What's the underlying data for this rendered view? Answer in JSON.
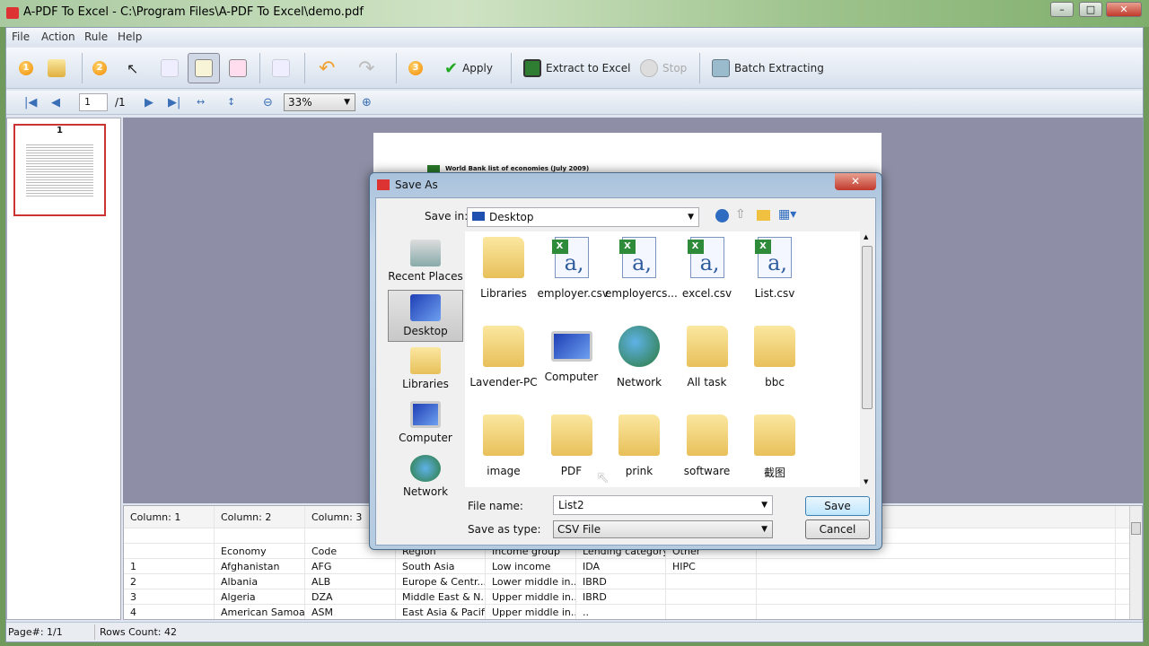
{
  "window": {
    "title": "A-PDF To Excel - C:\\Program Files\\A-PDF To Excel\\demo.pdf",
    "minimize": "–",
    "maximize": "□",
    "close": "✕"
  },
  "menu": [
    "File",
    "Action",
    "Rule",
    "Help"
  ],
  "toolbar": {
    "step1": "1",
    "step2": "2",
    "step3": "3",
    "apply": "Apply",
    "extract": "Extract to Excel",
    "stop": "Stop",
    "batch": "Batch Extracting"
  },
  "nav": {
    "page": "1",
    "total": "/1",
    "zoom": "33%"
  },
  "thumbnail": {
    "label": "1"
  },
  "pdf": {
    "heading": "World Bank list of economies (July 2009)"
  },
  "grid": {
    "headers": [
      "Column: 1",
      "Column: 2",
      "Column: 3",
      "",
      "",
      "",
      "",
      ""
    ],
    "rows": [
      [
        "",
        "",
        "",
        "",
        "",
        "",
        "",
        ""
      ],
      [
        "",
        "Economy",
        "Code",
        "Region",
        "Income group",
        "Lending category",
        "Other",
        ""
      ],
      [
        "1",
        "Afghanistan",
        "AFG",
        "South Asia",
        "Low income",
        "IDA",
        "HIPC",
        ""
      ],
      [
        "2",
        "Albania",
        "ALB",
        "Europe & Centr...",
        "Lower middle in...",
        "IBRD",
        "",
        ""
      ],
      [
        "3",
        "Algeria",
        "DZA",
        "Middle East & N...",
        "Upper middle in...",
        "IBRD",
        "",
        ""
      ],
      [
        "4",
        "American Samoa",
        "ASM",
        "East Asia & Pacific",
        "Upper middle in...",
        "..",
        "",
        ""
      ]
    ]
  },
  "status": {
    "page": "Page#: 1/1",
    "rows": "Rows Count: 42"
  },
  "dialog": {
    "title": "Save As",
    "close": "✕",
    "save_in_label": "Save in:",
    "save_in_value": "Desktop",
    "places": [
      {
        "label": "Recent Places",
        "icon": "recent-places-icon"
      },
      {
        "label": "Desktop",
        "icon": "desktop-icon"
      },
      {
        "label": "Libraries",
        "icon": "libraries-icon"
      },
      {
        "label": "Computer",
        "icon": "computer-icon"
      },
      {
        "label": "Network",
        "icon": "network-icon"
      }
    ],
    "items": [
      {
        "label": "Libraries",
        "icon": "libraries-icon"
      },
      {
        "label": "employer.csv",
        "icon": "csv-file-icon"
      },
      {
        "label": "employercs...",
        "icon": "csv-file-icon"
      },
      {
        "label": "excel.csv",
        "icon": "csv-file-icon"
      },
      {
        "label": "List.csv",
        "icon": "csv-file-icon"
      },
      {
        "label": "Lavender-PC",
        "icon": "user-folder-icon"
      },
      {
        "label": "Computer",
        "icon": "computer-icon"
      },
      {
        "label": "Network",
        "icon": "network-icon"
      },
      {
        "label": "All task",
        "icon": "folder-icon"
      },
      {
        "label": "bbc",
        "icon": "folder-icon"
      },
      {
        "label": "image",
        "icon": "folder-icon"
      },
      {
        "label": "PDF",
        "icon": "folder-icon"
      },
      {
        "label": "prink",
        "icon": "folder-icon"
      },
      {
        "label": "software",
        "icon": "folder-icon"
      },
      {
        "label": "截图",
        "icon": "folder-icon"
      }
    ],
    "file_name_label": "File name:",
    "file_name_value": "List2",
    "type_label": "Save as type:",
    "type_value": "CSV File",
    "save": "Save",
    "cancel": "Cancel"
  }
}
